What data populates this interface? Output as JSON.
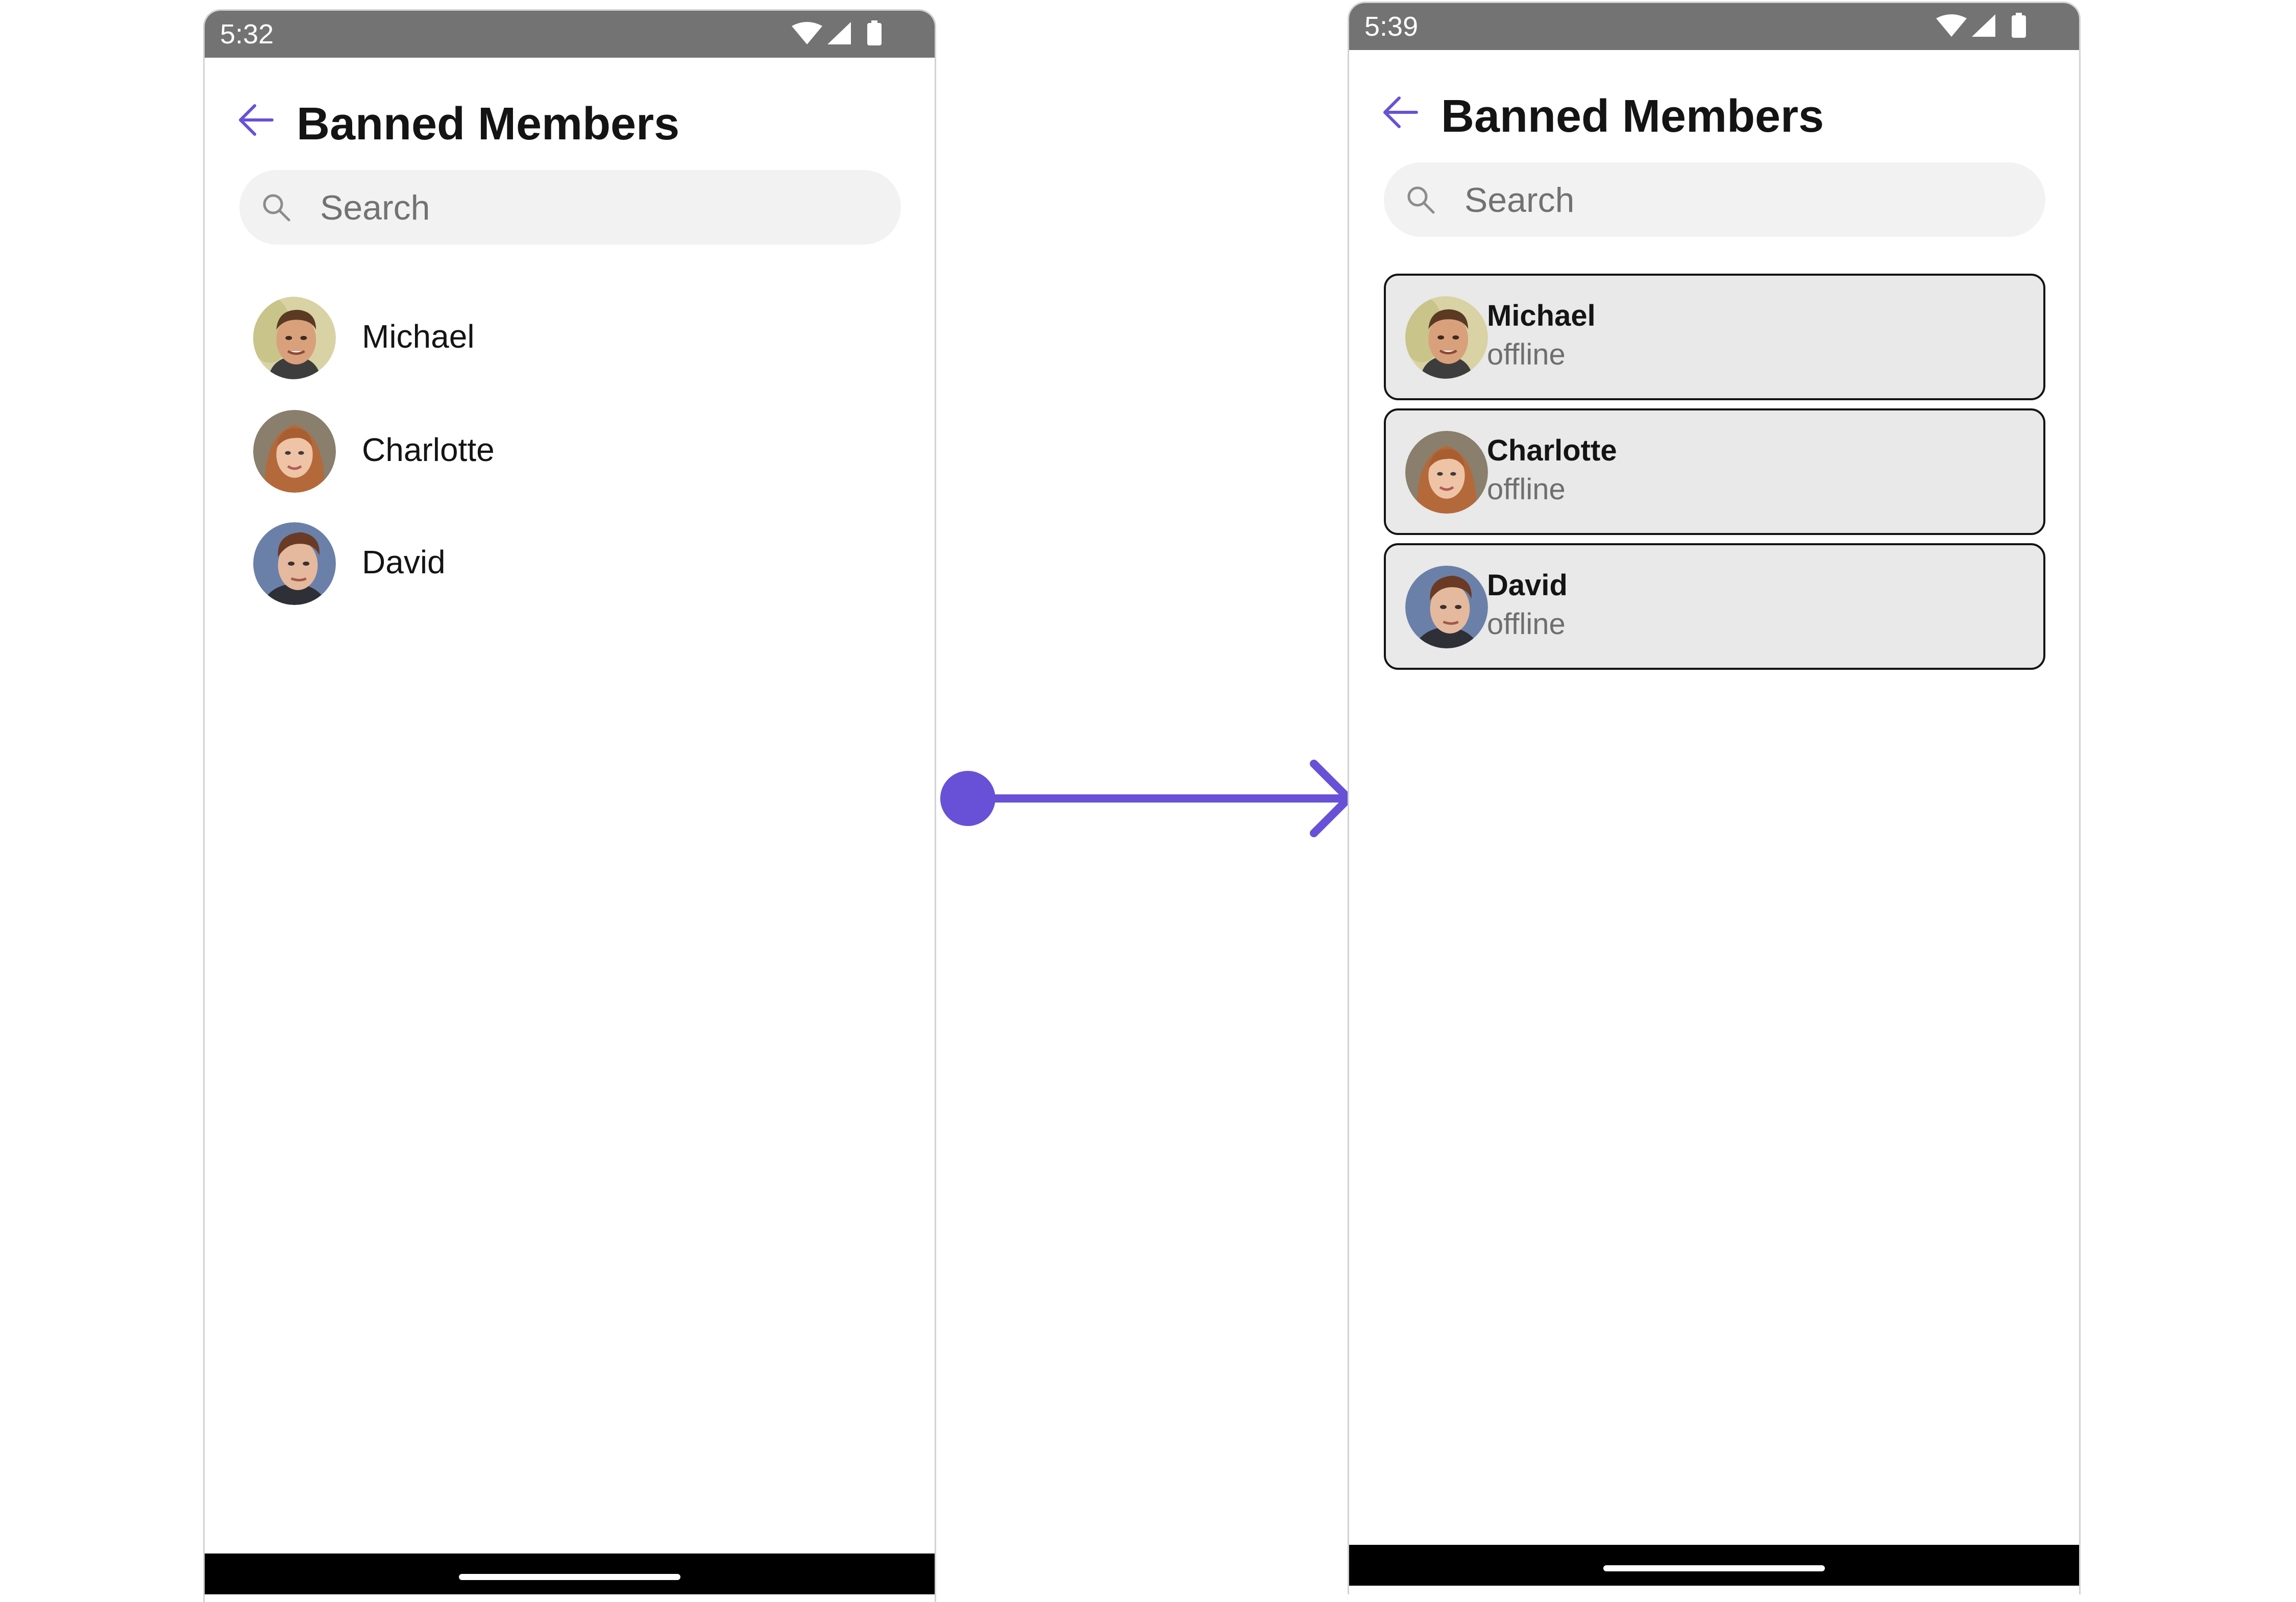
{
  "screens": [
    {
      "status_time": "5:32",
      "header": {
        "title": "Banned Members"
      },
      "search": {
        "placeholder": "Search"
      },
      "members": [
        {
          "name": "Michael"
        },
        {
          "name": "Charlotte"
        },
        {
          "name": "David"
        }
      ]
    },
    {
      "status_time": "5:39",
      "header": {
        "title": "Banned Members"
      },
      "search": {
        "placeholder": "Search"
      },
      "members": [
        {
          "name": "Michael",
          "status": "offline"
        },
        {
          "name": "Charlotte",
          "status": "offline"
        },
        {
          "name": "David",
          "status": "offline"
        }
      ]
    }
  ],
  "icons": {
    "back": "arrow-left-icon",
    "search": "search-icon",
    "wifi": "wifi-icon",
    "signal": "cellular-signal-icon",
    "battery": "battery-icon"
  },
  "colors": {
    "accent": "#6851d6",
    "status_bar": "#737373",
    "search_bg": "#f2f2f2",
    "card_bg": "#e8e9e8",
    "card_border": "#141414",
    "nav_bar": "#000000"
  }
}
